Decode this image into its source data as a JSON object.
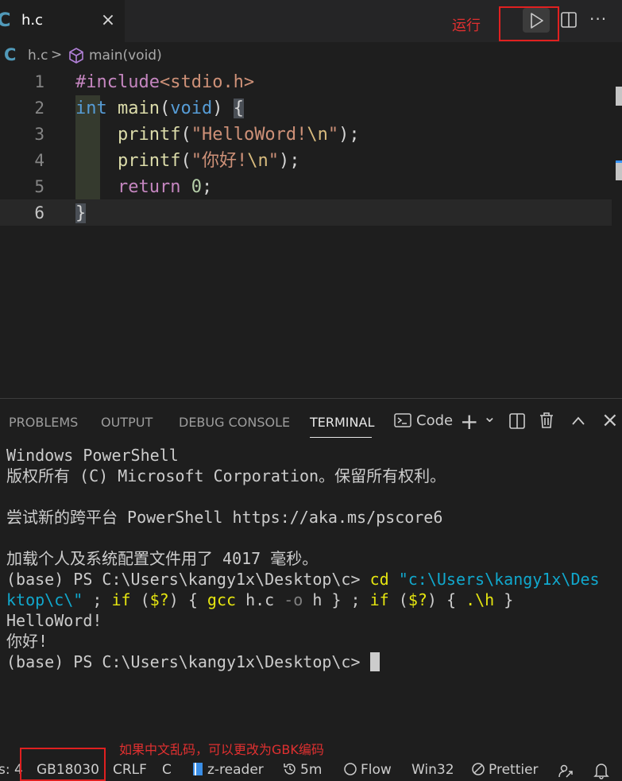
{
  "tab": {
    "title": "h.c",
    "lang_icon": "C",
    "close": "×"
  },
  "toolbar": {
    "run_label": "运行",
    "more": "···"
  },
  "breadcrumb": {
    "lang_icon": "C",
    "file": "h.c",
    "separator": ">",
    "symbol": "main(void)"
  },
  "editor": {
    "line_numbers": [
      "1",
      "2",
      "3",
      "4",
      "5",
      "6"
    ],
    "active_line": 6,
    "lines": [
      [
        {
          "t": "#include",
          "c": "kw-pre"
        },
        {
          "t": "<stdio.h>",
          "c": "str"
        }
      ],
      [
        {
          "t": "int",
          "c": "kw-type"
        },
        {
          "t": " ",
          "c": "punc"
        },
        {
          "t": "main",
          "c": "fn"
        },
        {
          "t": "(",
          "c": "punc"
        },
        {
          "t": "void",
          "c": "kw-type"
        },
        {
          "t": ") ",
          "c": "punc"
        },
        {
          "t": "{",
          "c": "brace-hl"
        }
      ],
      [
        {
          "t": "    ",
          "c": "punc"
        },
        {
          "t": "printf",
          "c": "fn"
        },
        {
          "t": "(",
          "c": "punc"
        },
        {
          "t": "\"HelloWord!",
          "c": "str"
        },
        {
          "t": "\\n",
          "c": "esc"
        },
        {
          "t": "\"",
          "c": "str"
        },
        {
          "t": ");",
          "c": "punc"
        }
      ],
      [
        {
          "t": "    ",
          "c": "punc"
        },
        {
          "t": "printf",
          "c": "fn"
        },
        {
          "t": "(",
          "c": "punc"
        },
        {
          "t": "\"你好!",
          "c": "str"
        },
        {
          "t": "\\n",
          "c": "esc"
        },
        {
          "t": "\"",
          "c": "str"
        },
        {
          "t": ");",
          "c": "punc"
        }
      ],
      [
        {
          "t": "    ",
          "c": "punc"
        },
        {
          "t": "return",
          "c": "kw-pre"
        },
        {
          "t": " ",
          "c": "punc"
        },
        {
          "t": "0",
          "c": "num"
        },
        {
          "t": ";",
          "c": "punc"
        }
      ],
      [
        {
          "t": "}",
          "c": "brace-hl"
        }
      ]
    ]
  },
  "panel": {
    "tabs": [
      "PROBLEMS",
      "OUTPUT",
      "DEBUG CONSOLE",
      "TERMINAL"
    ],
    "active_tab": "TERMINAL",
    "terminal_selector": "Code",
    "add": "+",
    "chevron": "⌄",
    "collapse": "^",
    "close": "×"
  },
  "terminal": {
    "lines": [
      [
        {
          "t": "Windows PowerShell",
          "c": ""
        }
      ],
      [
        {
          "t": "版权所有 (C) Microsoft Corporation。保留所有权利。",
          "c": ""
        }
      ],
      [
        {
          "t": "",
          "c": ""
        }
      ],
      [
        {
          "t": "尝试新的跨平台 PowerShell https://aka.ms/pscore6",
          "c": ""
        }
      ],
      [
        {
          "t": "",
          "c": ""
        }
      ],
      [
        {
          "t": "加载个人及系统配置文件用了 4017 毫秒。",
          "c": ""
        }
      ],
      [
        {
          "t": "(base) PS C:\\Users\\kangy1x\\Desktop\\c> ",
          "c": ""
        },
        {
          "t": "cd",
          "c": "t-yellow"
        },
        {
          "t": " ",
          "c": ""
        },
        {
          "t": "\"c:\\Users\\kangy1x\\Des",
          "c": "t-cyan"
        }
      ],
      [
        {
          "t": "ktop\\c\\\"",
          "c": "t-cyan"
        },
        {
          "t": " ; ",
          "c": ""
        },
        {
          "t": "if",
          "c": "t-yellow"
        },
        {
          "t": " (",
          "c": ""
        },
        {
          "t": "$?",
          "c": "t-yellow"
        },
        {
          "t": ") { ",
          "c": ""
        },
        {
          "t": "gcc",
          "c": "t-yellow"
        },
        {
          "t": " h.c ",
          "c": ""
        },
        {
          "t": "-o",
          "c": "t-gray"
        },
        {
          "t": " h } ; ",
          "c": ""
        },
        {
          "t": "if",
          "c": "t-yellow"
        },
        {
          "t": " (",
          "c": ""
        },
        {
          "t": "$?",
          "c": "t-yellow"
        },
        {
          "t": ") { ",
          "c": ""
        },
        {
          "t": ".\\h",
          "c": "t-yellow"
        },
        {
          "t": " }",
          "c": ""
        }
      ],
      [
        {
          "t": "HelloWord!",
          "c": ""
        }
      ],
      [
        {
          "t": "你好!",
          "c": ""
        }
      ],
      [
        {
          "t": "(base) PS C:\\Users\\kangy1x\\Desktop\\c> ",
          "c": ""
        }
      ]
    ]
  },
  "statusbar": {
    "spaces": "s: 4",
    "encoding": "GB18030",
    "eol": "CRLF",
    "language": "C",
    "reader": "z-reader",
    "time": "5m",
    "flow": "Flow",
    "platform": "Win32",
    "prettier": "Prettier"
  },
  "annotation": "如果中文乱码，可以更改为GBK编码",
  "colors": {
    "accent_red": "#e02020",
    "bg": "#1e1e1e",
    "c_icon": "#519aba"
  }
}
